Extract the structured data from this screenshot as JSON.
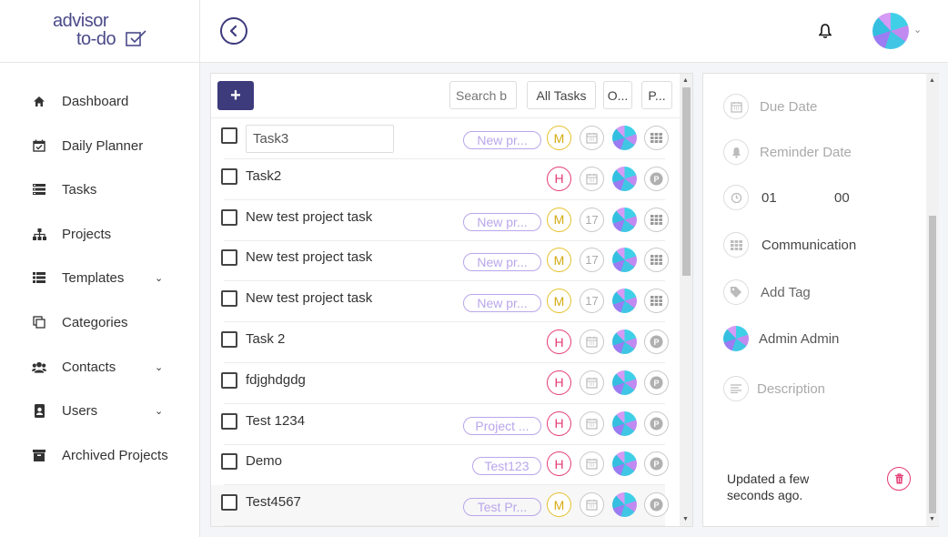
{
  "logo": {
    "line1": "advisor",
    "line2": "to-do"
  },
  "sidebar": {
    "items": [
      {
        "label": "Dashboard",
        "icon": "home-icon"
      },
      {
        "label": "Daily Planner",
        "icon": "calendar-check-icon"
      },
      {
        "label": "Tasks",
        "icon": "tasks-icon"
      },
      {
        "label": "Projects",
        "icon": "sitemap-icon"
      },
      {
        "label": "Templates",
        "icon": "list-icon",
        "expandable": true
      },
      {
        "label": "Categories",
        "icon": "copy-icon"
      },
      {
        "label": "Contacts",
        "icon": "users-icon",
        "expandable": true
      },
      {
        "label": "Users",
        "icon": "address-book-icon",
        "expandable": true
      },
      {
        "label": "Archived Projects",
        "icon": "archive-icon"
      }
    ]
  },
  "toolbar": {
    "add_label": "+",
    "search_placeholder": "Search b",
    "filters": [
      "All Tasks",
      "O...",
      "P..."
    ]
  },
  "tasks": [
    {
      "name": "Task3",
      "editing": true,
      "project": "New pr...",
      "priority": "M",
      "due": "",
      "category": "grid"
    },
    {
      "name": "Task2",
      "project": "",
      "priority": "H",
      "due": "",
      "category": "P"
    },
    {
      "name": "New test project task",
      "project": "New pr...",
      "priority": "M",
      "due": "17",
      "category": "grid"
    },
    {
      "name": "New test project task",
      "project": "New pr...",
      "priority": "M",
      "due": "17",
      "category": "grid"
    },
    {
      "name": "New test project task",
      "project": "New pr...",
      "priority": "M",
      "due": "17",
      "category": "grid"
    },
    {
      "name": "Task 2",
      "project": "",
      "priority": "H",
      "due": "",
      "category": "P"
    },
    {
      "name": "fdjghdgdg",
      "project": "",
      "priority": "H",
      "due": "",
      "category": "P"
    },
    {
      "name": "Test 1234",
      "project": "Project ...",
      "priority": "H",
      "due": "",
      "category": "P"
    },
    {
      "name": "Demo",
      "project": "Test123",
      "priority": "H",
      "due": "",
      "category": "P"
    },
    {
      "name": "Test4567",
      "project": "Test Pr...",
      "priority": "M",
      "due": "",
      "category": "P"
    }
  ],
  "detail": {
    "due_date": "Due Date",
    "reminder_date": "Reminder Date",
    "time_hours": "01",
    "time_minutes": "00",
    "category": "Communication",
    "add_tag": "Add Tag",
    "assignee": "Admin Admin",
    "description": "Description",
    "updated": "Updated a few seconds ago."
  },
  "colors": {
    "brand": "#3d3b7c",
    "priority_high": "#e43a74",
    "priority_medium": "#e5c02a",
    "project_pill": "#b9a6ea"
  }
}
